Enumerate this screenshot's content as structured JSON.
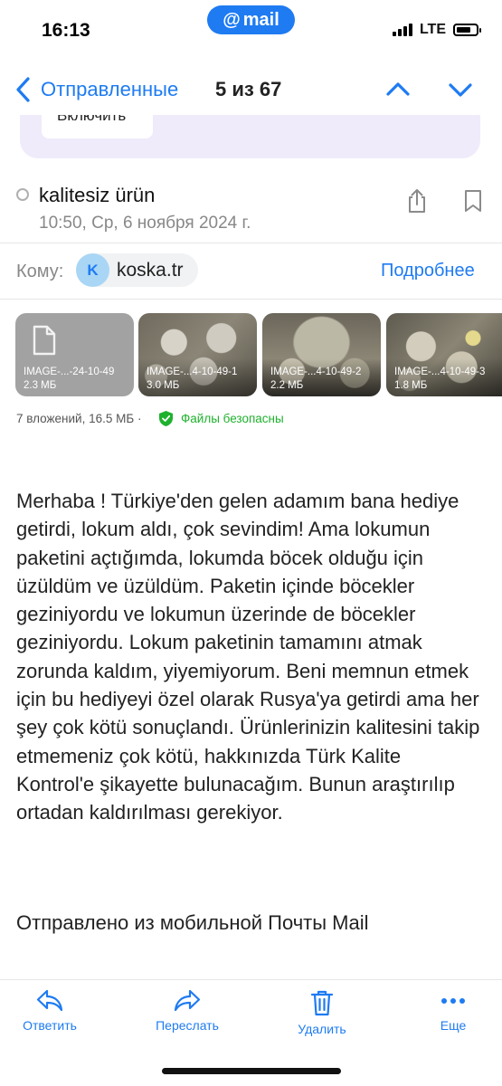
{
  "status_bar": {
    "time": "16:13",
    "app_badge": "mail",
    "network": "LTE"
  },
  "nav": {
    "folder": "Отправленные",
    "position": "5 из 67"
  },
  "promo": {
    "button_label": "Включить"
  },
  "message": {
    "subject": "kalitesiz ürün",
    "date": "10:50, Ср, 6 ноября 2024 г.",
    "to_label": "Кому:",
    "recipient_initial": "K",
    "recipient": "koska.tr",
    "details_link": "Подробнее"
  },
  "attachments": {
    "items": [
      {
        "name": "IMAGE-...-24-10-49",
        "size": "2.3 МБ"
      },
      {
        "name": "IMAGE-...4-10-49-1",
        "size": "3.0 МБ"
      },
      {
        "name": "IMAGE-...4-10-49-2",
        "size": "2.2 МБ"
      },
      {
        "name": "IMAGE-...4-10-49-3",
        "size": "1.8 МБ"
      }
    ],
    "summary": "7 вложений, 16.5 МБ ·",
    "safe_text": "Файлы безопасны"
  },
  "body": {
    "text": "Merhaba ! Türkiye'den gelen adamım bana hediye getirdi, lokum aldı, çok sevindim! Ama lokumun paketini açtığımda, lokumda böcek olduğu için üzüldüm ve üzüldüm. Paketin içinde böcekler geziniyordu ve lokumun üzerinde de böcekler geziniyordu. Lokum paketinin tamamını atmak zorunda kaldım, yiyemiyorum. Beni memnun etmek için bu hediyeyi özel olarak Rusya'ya getirdi ama her şey çok kötü sonuçlandı. Ürünlerinizin kalitesini takip etmemeniz çok kötü, hakkınızda Türk Kalite Kontrol'e şikayette bulunacağım. Bunun araştırılıp ortadan kaldırılması gerekiyor.",
    "signature": "Отправлено из мобильной Почты Mail"
  },
  "toolbar": {
    "reply": "Ответить",
    "forward": "Переслать",
    "delete": "Удалить",
    "more": "Еще"
  },
  "colors": {
    "accent": "#1e7bf2",
    "safe": "#1eb12d",
    "promo_bg": "#efebfb"
  }
}
